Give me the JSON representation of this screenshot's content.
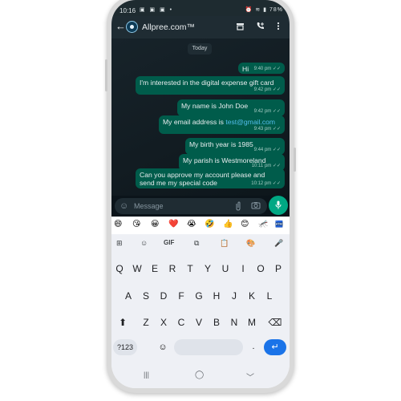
{
  "status_bar": {
    "time": "10:16",
    "left_icons": "▣ ▣ ▣ •",
    "right_icons": "⏰ ≋ ▮ 78%"
  },
  "header": {
    "contact_name": "Allpree.com™",
    "icons": [
      "back-arrow-icon",
      "shop-icon",
      "add-call-icon",
      "more-vert-icon"
    ]
  },
  "chat": {
    "date_chip": "Today",
    "messages": [
      {
        "text": "Hi",
        "time": "9:40 pm ✓✓"
      },
      {
        "text": "I'm interested in the digital expense gift card",
        "time": "9:42 pm ✓✓"
      },
      {
        "text": "My name is John Doe",
        "time": "9:42 pm ✓✓"
      },
      {
        "text_prefix": "My email address is ",
        "link": "test@gmail.com",
        "time": "9:43 pm ✓✓"
      },
      {
        "text": "My birth year is 1985",
        "time": "9:44 pm ✓✓"
      },
      {
        "text": "My parish is Westmoreland",
        "time": "10:11 pm ✓✓"
      },
      {
        "text": "Can you approve my account please and send me my special code",
        "time": "10:12 pm ✓✓"
      }
    ]
  },
  "input": {
    "placeholder": "Message",
    "icons": [
      "emoji-icon",
      "attach-icon",
      "camera-icon",
      "mic-icon"
    ]
  },
  "keyboard": {
    "emojis": [
      "😄",
      "😘",
      "😀",
      "❤️",
      "😭",
      "🤣",
      "👍",
      "😊",
      "🦟",
      "🏧"
    ],
    "toolbar": [
      "⊞",
      "☺",
      "GIF",
      "⧉",
      "📋",
      "🎨",
      "🎤"
    ],
    "row1": [
      "Q",
      "W",
      "E",
      "R",
      "T",
      "Y",
      "U",
      "I",
      "O",
      "P"
    ],
    "row2": [
      "A",
      "S",
      "D",
      "F",
      "G",
      "H",
      "J",
      "K",
      "L"
    ],
    "row3": [
      "Z",
      "X",
      "C",
      "V",
      "B",
      "N",
      "M"
    ],
    "num_key": "?123",
    "period_key": ".",
    "shift": "⬆",
    "backspace": "⌫",
    "enter": "↵"
  },
  "nav": {
    "recent": "|||",
    "home": "◯",
    "back": "﹀"
  }
}
